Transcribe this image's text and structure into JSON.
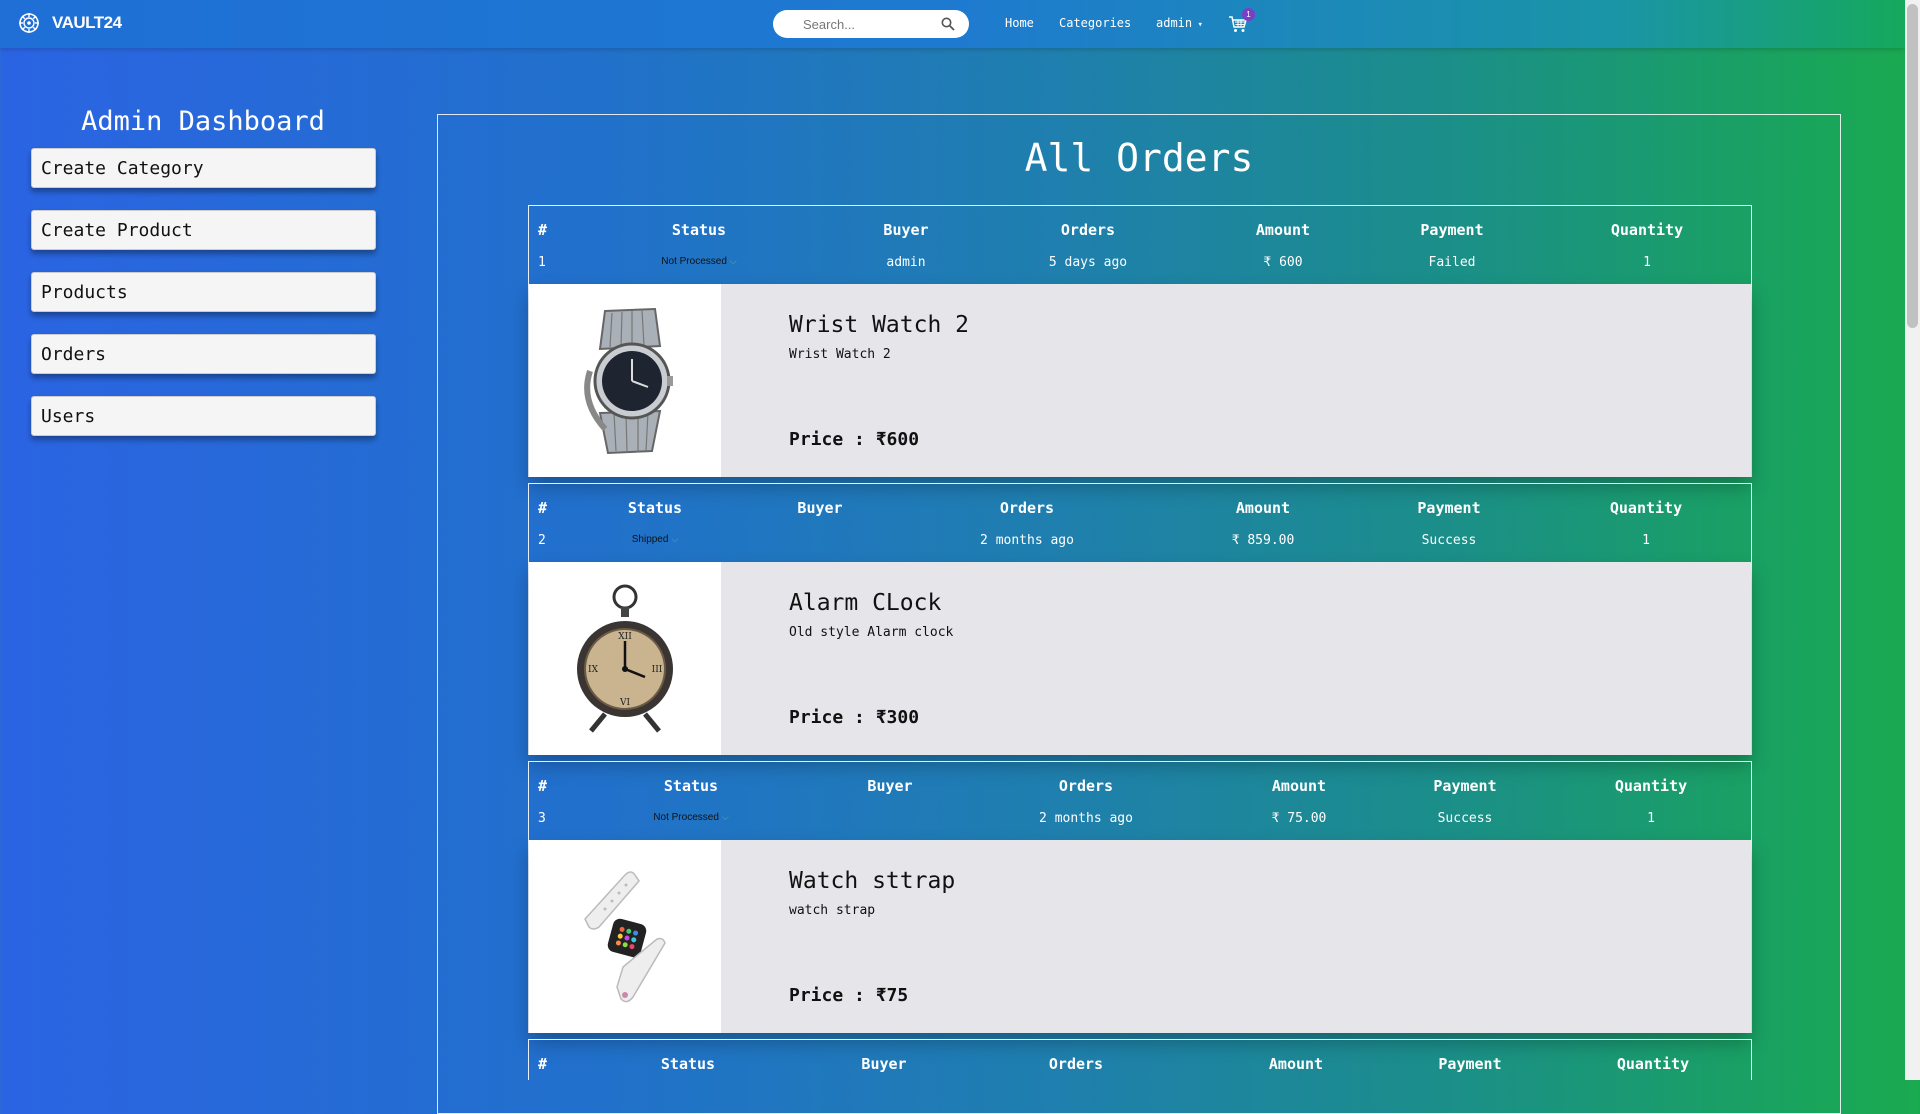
{
  "navbar": {
    "brand": "VAULT24",
    "search_placeholder": "Search...",
    "home": "Home",
    "categories": "Categories",
    "user": "admin",
    "cart_count": "1"
  },
  "sidebar": {
    "title": "Admin Dashboard",
    "items": [
      {
        "label": "Create Category"
      },
      {
        "label": "Create Product"
      },
      {
        "label": "Products"
      },
      {
        "label": "Orders"
      },
      {
        "label": "Users"
      }
    ]
  },
  "main": {
    "title": "All Orders",
    "headers": [
      "#",
      "Status",
      "Buyer",
      "Orders",
      "Amount",
      "Payment",
      "Quantity"
    ],
    "orders": [
      {
        "num": "1",
        "status": "Not Processed",
        "buyer": "admin",
        "date": "5 days ago",
        "amount": "₹ 600",
        "payment": "Failed",
        "quantity": "1",
        "product": {
          "name": "Wrist Watch 2",
          "description": "Wrist Watch 2",
          "price": "Price : ₹600",
          "image": "wrist-watch"
        }
      },
      {
        "num": "2",
        "status": "Shipped",
        "buyer": "",
        "date": "2 months ago",
        "amount": "₹ 859.00",
        "payment": "Success",
        "quantity": "1",
        "product": {
          "name": "Alarm CLock",
          "description": "Old style Alarm clock",
          "price": "Price : ₹300",
          "image": "alarm-clock"
        }
      },
      {
        "num": "3",
        "status": "Not Processed",
        "buyer": "",
        "date": "2 months ago",
        "amount": "₹ 75.00",
        "payment": "Success",
        "quantity": "1",
        "product": {
          "name": "Watch sttrap",
          "description": "watch strap",
          "price": "Price : ₹75",
          "image": "watch-strap"
        }
      }
    ]
  }
}
